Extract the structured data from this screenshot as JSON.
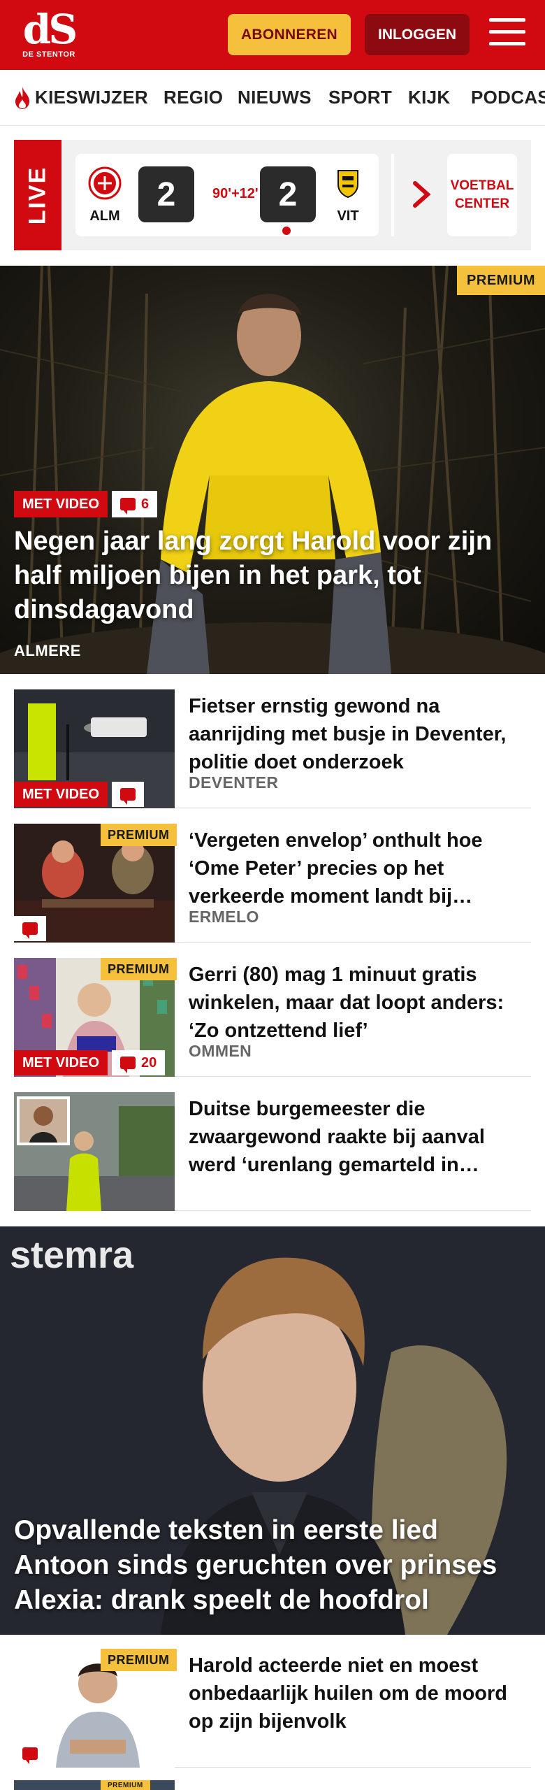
{
  "header": {
    "logo_mark": "dS",
    "logo_sub": "DE STENTOR",
    "subscribe_label": "ABONNEREN",
    "login_label": "INLOGGEN"
  },
  "nav": {
    "items": [
      "KIESWIJZER",
      "REGIO",
      "NIEUWS",
      "SPORT",
      "KIJK",
      "PODCAST"
    ]
  },
  "live": {
    "tag": "LIVE",
    "home_team": "ALM",
    "away_team": "VIT",
    "home_score": "2",
    "away_score": "2",
    "minute": "90'+12'",
    "center_link": "VOETBAL CENTER"
  },
  "hero": {
    "badge": "PREMIUM",
    "video_label": "MET VIDEO",
    "comments": "6",
    "title": "Negen jaar lang zorgt Harold voor zijn half miljoen bijen in het park, tot dinsdagavond",
    "location": "ALMERE"
  },
  "articles": [
    {
      "title": "Fietser ernstig gewond na aanrijding met busje in Deventer, politie doet onderzoek",
      "location": "DEVENTER",
      "video_label": "MET VIDEO"
    },
    {
      "badge": "PREMIUM",
      "title": "‘Vergeten envelop’ onthult hoe ‘Ome Peter’ precies op het verkeerde moment landt bij…",
      "location": "ERMELO"
    },
    {
      "badge": "PREMIUM",
      "title": "Gerri (80) mag 1 minuut gratis winkelen, maar dat loopt anders: ‘Zo ontzettend lief’",
      "location": "OMMEN",
      "video_label": "MET VIDEO",
      "comments": "20"
    },
    {
      "title": "Duitse burgemeester die zwaargewond raakte bij aanval werd ‘urenlang gemarteld in…"
    }
  ],
  "hero2": {
    "banner_text": "stemra",
    "title": "Opvallende teksten in eerste lied Antoon sinds geruchten over prinses Alexia: drank speelt de hoofdrol"
  },
  "article_after": {
    "badge": "PREMIUM",
    "title": "Harold acteerde niet en moest onbedaarlijk huilen om de moord op zijn bijenvolk"
  },
  "article_partial": {
    "badge": "PREMIUM"
  },
  "colors": {
    "brand_red": "#d10a11",
    "premium_yellow": "#f5c13c",
    "login_dark_red": "#8c0a10"
  }
}
